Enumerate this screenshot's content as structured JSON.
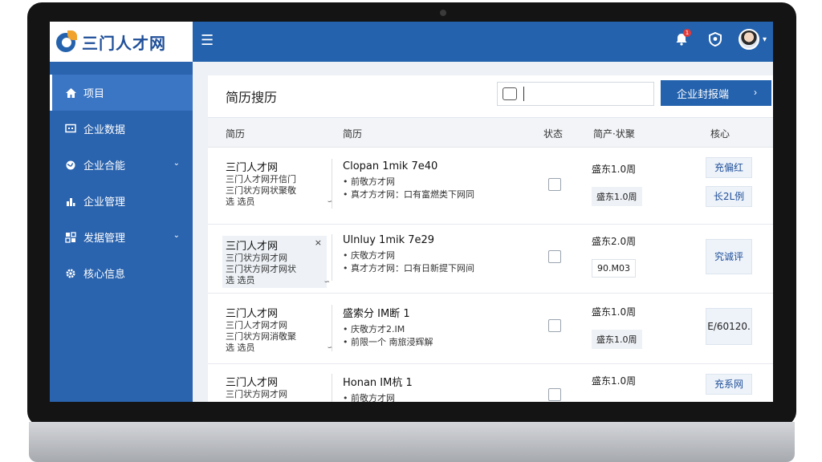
{
  "brand": {
    "name": "三门人才网"
  },
  "topbar": {
    "menu_icon": "hamburger-icon",
    "notification_badge": "1",
    "icons": [
      "bell-icon",
      "shield-icon",
      "avatar"
    ]
  },
  "sidebar": {
    "items": [
      {
        "label": "项目",
        "icon": "home-icon",
        "active": true,
        "expandable": false
      },
      {
        "label": "企业数据",
        "icon": "monitor-icon",
        "active": false,
        "expandable": false
      },
      {
        "label": "企业合能",
        "icon": "globe-icon",
        "active": false,
        "expandable": true
      },
      {
        "label": "企业管理",
        "icon": "users-icon",
        "active": false,
        "expandable": false
      },
      {
        "label": "发据管理",
        "icon": "grid-icon",
        "active": false,
        "expandable": true
      },
      {
        "label": "核心信息",
        "icon": "gear-icon",
        "active": false,
        "expandable": false
      }
    ]
  },
  "main": {
    "title": "简历搜历",
    "search": {
      "placeholder": "",
      "value": ""
    },
    "primary_button": "企业封报端",
    "columns": [
      "简历",
      "简历",
      "状态",
      "简产·状聚",
      "核心"
    ]
  },
  "rows": [
    {
      "company": "三门人才网",
      "company_lines": [
        "三门人才网开信门",
        "三门状方网状聚敬"
      ],
      "company_foot": "选 选员",
      "company_foot_mark": "∽",
      "company_x": "",
      "job_title": "Clopan 1mik 7e40",
      "job_lines": [
        "• 前敬方才网",
        "• 真才方才网：口有富燃类下网同"
      ],
      "meta_line": "盛东1.0周",
      "meta_tag": "盛东1.0周",
      "actions": [
        "充偏红",
        "长2L例"
      ]
    },
    {
      "company": "三门人才网",
      "company_lines": [
        "三门状方网才网",
        "三门状方网才网状"
      ],
      "company_foot": "选 选员",
      "company_foot_mark": "∽",
      "company_x": "×",
      "job_title": "Ulnluy 1mik 7e29",
      "job_lines": [
        "• 庆敬方才网",
        "• 真才方才网：口有日新提下网间"
      ],
      "meta_line": "盛东2.0周",
      "meta_tag": "90.M03",
      "actions": [
        "究诚评"
      ]
    },
    {
      "company": "三门人才网",
      "company_lines": [
        "三门人才网才网",
        "三门状方网消敬聚"
      ],
      "company_foot": "选 选员",
      "company_foot_mark": "∽",
      "company_x": "",
      "job_title": "盛索分 IM断 1",
      "job_lines": [
        "• 庆敬方才2.IM",
        "• 前限一个 南旅浸辉解"
      ],
      "meta_line": "盛东1.0周",
      "meta_tag": "盛东1.0周",
      "actions": [
        "E/60120."
      ]
    },
    {
      "company": "三门人才网",
      "company_lines": [
        "三门状方网才网"
      ],
      "company_foot": "",
      "company_foot_mark": "",
      "company_x": "",
      "job_title": "Honan IM杭 1",
      "job_lines": [
        "• 前敬方才网"
      ],
      "meta_line": "盛东1.0周",
      "meta_tag": "",
      "actions": [
        "充系网"
      ]
    }
  ]
}
